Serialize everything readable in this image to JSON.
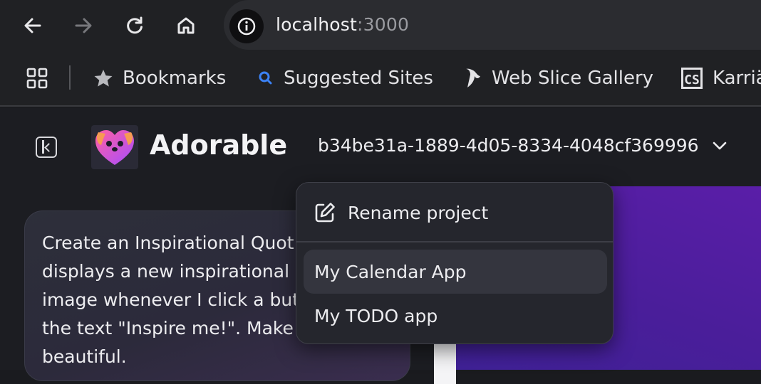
{
  "browser": {
    "url_host": "localhost",
    "url_port": ":3000",
    "bookmarks": [
      {
        "label": "Bookmarks",
        "icon": "star-icon"
      },
      {
        "label": "Suggested Sites",
        "icon": "search-icon"
      },
      {
        "label": "Web Slice Gallery",
        "icon": "web-slice-icon"
      },
      {
        "label": "Karriä",
        "icon": "cs-icon"
      }
    ]
  },
  "app": {
    "brand": "Adorable",
    "project_id": "b34be31a-1889-4d05-8334-4048cf369996",
    "chat_message": "Create an Inspirational Quot displays a new inspirational c image whenever I click a butt the text \"Inspire me!\". Make beautiful.",
    "chat_lines": [
      "Create an Inspirational Quot",
      "displays a new inspirational c",
      "image whenever I click a butt",
      "the text \"Inspire me!\". Make",
      "beautiful."
    ]
  },
  "menu": {
    "rename_label": "Rename project",
    "projects": [
      {
        "label": "My Calendar App",
        "active": true
      },
      {
        "label": "My TODO app",
        "active": false
      }
    ]
  },
  "colors": {
    "accent_purple": "#5a1ea8",
    "menu_bg": "#25262d",
    "chrome_bg": "#202124"
  }
}
